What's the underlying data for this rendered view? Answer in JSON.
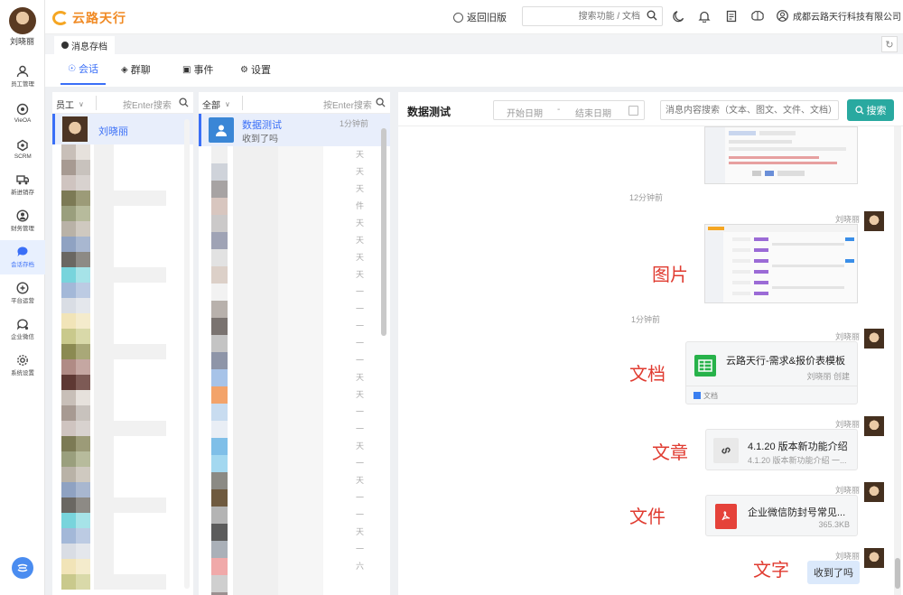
{
  "app": {
    "logo_text": "云路天行",
    "back_old": "返回旧版",
    "search_placeholder": "搜索功能 / 文档",
    "company": "成都云路天行科技有限公司"
  },
  "nav": {
    "username": "刘晓丽",
    "items": [
      {
        "label": "员工管理",
        "icon": "person-icon"
      },
      {
        "label": "VieOA",
        "icon": "oa-icon"
      },
      {
        "label": "SCRM",
        "icon": "scrm-icon"
      },
      {
        "label": "新进销存",
        "icon": "truck-icon"
      },
      {
        "label": "财务管理",
        "icon": "finance-icon"
      },
      {
        "label": "会话存档",
        "icon": "chat-archive-icon"
      },
      {
        "label": "平台运营",
        "icon": "platform-icon"
      },
      {
        "label": "企业微信",
        "icon": "wecom-icon"
      },
      {
        "label": "系统设置",
        "icon": "settings-icon"
      }
    ]
  },
  "tab_page": "消息存档",
  "subtabs": [
    {
      "label": "会话"
    },
    {
      "label": "群聊"
    },
    {
      "label": "事件"
    },
    {
      "label": "设置"
    }
  ],
  "employees": {
    "filter": "员工",
    "placeholder": "按Enter搜索",
    "selected_name": "刘晓丽"
  },
  "conversations": {
    "filter": "全部",
    "placeholder": "按Enter搜索",
    "selected": {
      "name": "数据测试",
      "message": "收到了吗",
      "time": "1分钟前"
    },
    "partial_labels": [
      "天",
      "天",
      "天",
      "件",
      "天",
      "天",
      "天",
      "天",
      "一",
      "一",
      "一",
      "一",
      "一",
      "天",
      "天",
      "一",
      "一",
      "天",
      "一",
      "天",
      "一",
      "一",
      "天",
      "一",
      "六"
    ]
  },
  "chat": {
    "title": "数据测试",
    "start_date": "开始日期",
    "date_sep": "-",
    "end_date": "结束日期",
    "search_placeholder": "消息内容搜索（文本、图文、文件、文档）",
    "search_button": "搜索",
    "messages": {
      "ts1": "12分钟前",
      "ts2": "1分钟前",
      "sender": "刘晓丽",
      "doc_title": "云路天行-需求&报价表模板",
      "doc_creator": "刘晓丽 创建",
      "doc_tag": "文档",
      "link_title": "4.1.20 版本新功能介绍",
      "link_desc": "4.1.20 版本新功能介绍 一...",
      "file_name": "企业微信防封号常见...",
      "file_size": "365.3KB",
      "text": "收到了吗"
    },
    "annotations": {
      "image": "图片",
      "doc": "文档",
      "article": "文章",
      "file": "文件",
      "text": "文字"
    }
  },
  "colors": {
    "accent": "#3a6ff7",
    "search_button": "#29a9a0",
    "annotation": "#e03b30",
    "logo": "#f08a24"
  }
}
